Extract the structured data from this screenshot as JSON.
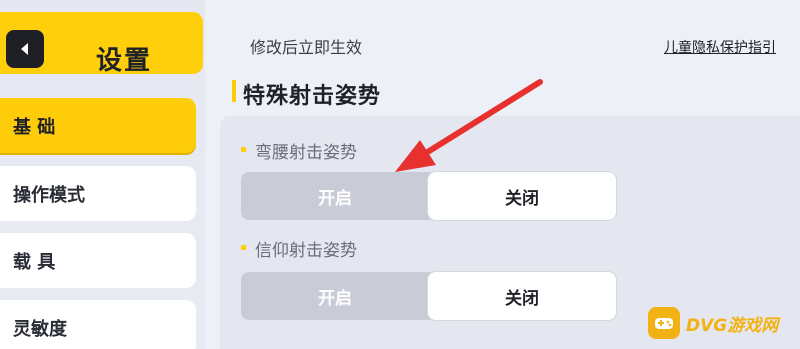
{
  "header": {
    "title": "设置",
    "back_icon": "back-arrow-icon"
  },
  "sidebar": {
    "items": [
      {
        "label": "基 础",
        "active": true
      },
      {
        "label": "操作模式",
        "active": false
      },
      {
        "label": "载 具",
        "active": false
      },
      {
        "label": "灵敏度",
        "active": false
      }
    ]
  },
  "main": {
    "hint": "修改后立即生效",
    "privacy_link": "儿童隐私保护指引",
    "section_title": "特殊射击姿势",
    "options": [
      {
        "label": "弯腰射击姿势",
        "on_label": "开启",
        "off_label": "关闭",
        "selected": "关闭"
      },
      {
        "label": "信仰射击姿势",
        "on_label": "开启",
        "off_label": "关闭",
        "selected": "关闭"
      }
    ]
  },
  "annotation": {
    "arrow_color": "#e8302f"
  },
  "watermark": {
    "text": "DVG游戏网"
  },
  "colors": {
    "accent": "#ffcc0a",
    "panel": "#e4e7ef",
    "toggle_track": "#c9ccd6"
  }
}
